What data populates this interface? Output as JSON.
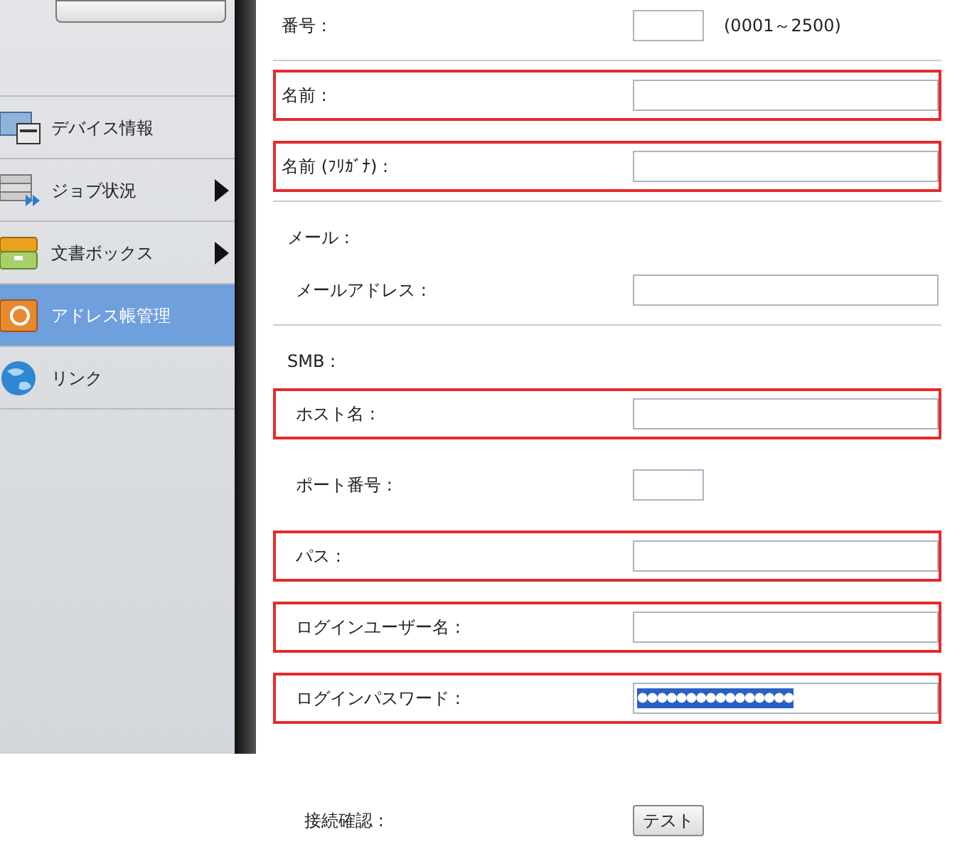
{
  "sidebar": {
    "items": [
      {
        "label": "デバイス情報",
        "submenu": false,
        "selected": false
      },
      {
        "label": "ジョブ状況",
        "submenu": true,
        "selected": false
      },
      {
        "label": "文書ボックス",
        "submenu": true,
        "selected": false
      },
      {
        "label": "アドレス帳管理",
        "submenu": false,
        "selected": true
      },
      {
        "label": "リンク",
        "submenu": false,
        "selected": false
      }
    ]
  },
  "form": {
    "rows": [
      {
        "kind": "field",
        "label": "番号 :",
        "input": {
          "kind": "short"
        },
        "note": "(0001～2500)",
        "highlighted": false,
        "indented": false,
        "divider_after": true
      },
      {
        "kind": "field",
        "label": "名前 :",
        "input": {
          "kind": "long"
        },
        "highlighted": true,
        "indented": false,
        "divider_after": false
      },
      {
        "kind": "field",
        "label": "名前 (ﾌﾘｶﾞﾅ) :",
        "input": {
          "kind": "long"
        },
        "highlighted": true,
        "indented": false,
        "divider_after": true
      },
      {
        "kind": "section",
        "label": "メール :"
      },
      {
        "kind": "field",
        "label": "メールアドレス :",
        "input": {
          "kind": "long"
        },
        "highlighted": false,
        "indented": true,
        "divider_after": true
      },
      {
        "kind": "section",
        "label": "SMB :"
      },
      {
        "kind": "field",
        "label": "ホスト名 :",
        "input": {
          "kind": "long"
        },
        "highlighted": true,
        "indented": true,
        "divider_after": false
      },
      {
        "kind": "field",
        "label": "ポート番号 :",
        "input": {
          "kind": "short"
        },
        "highlighted": false,
        "indented": true,
        "divider_after": false
      },
      {
        "kind": "field",
        "label": "パス :",
        "input": {
          "kind": "long"
        },
        "highlighted": true,
        "indented": true,
        "divider_after": false
      },
      {
        "kind": "field",
        "label": "ログインユーザー名 :",
        "input": {
          "kind": "long"
        },
        "highlighted": true,
        "indented": true,
        "divider_after": false
      },
      {
        "kind": "field",
        "label": "ログインパスワード :",
        "input": {
          "kind": "long",
          "value": "●●●●●●●●●●●●●●●●",
          "selected": true
        },
        "highlighted": true,
        "indented": true,
        "divider_after": false
      },
      {
        "kind": "button",
        "label": "接続確認 :",
        "button": "テスト"
      }
    ]
  }
}
